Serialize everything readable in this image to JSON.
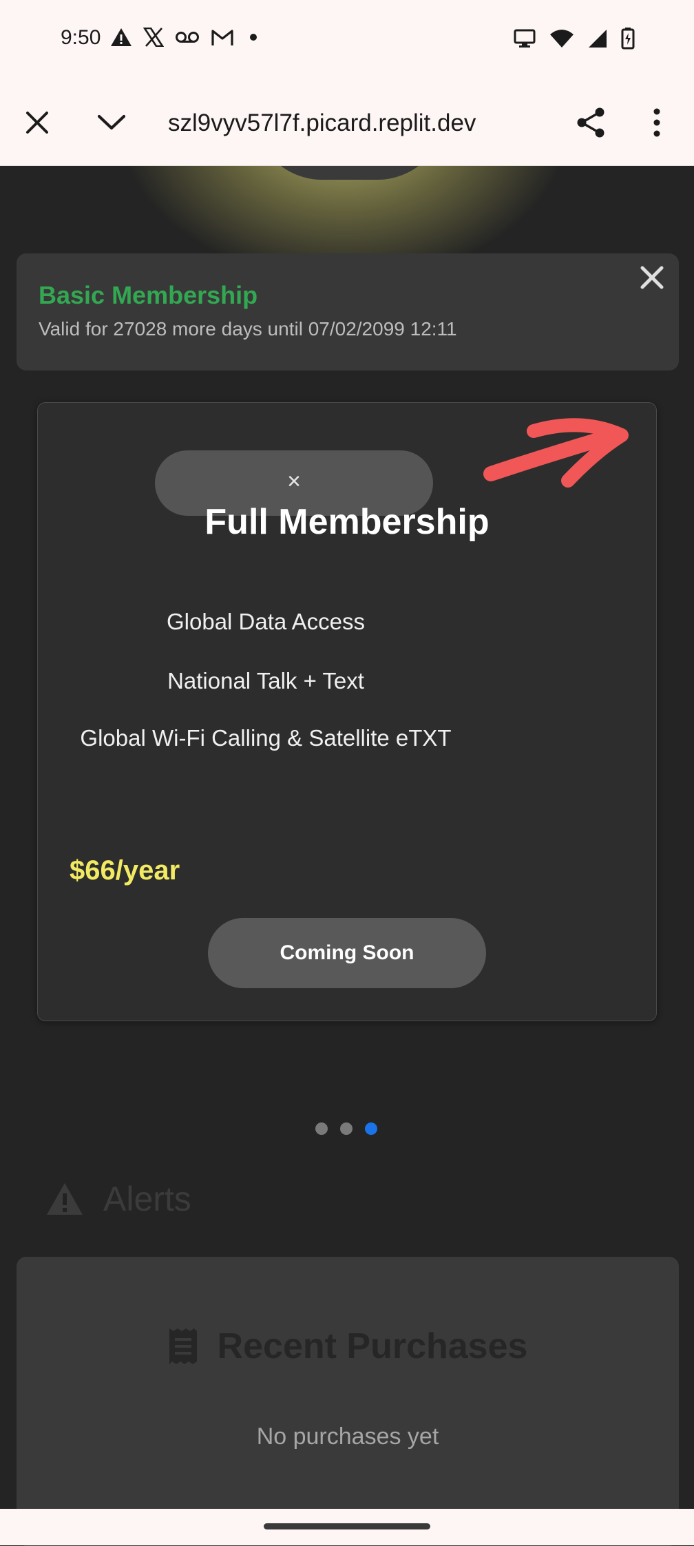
{
  "status_bar": {
    "time": "9:50",
    "left_icons": [
      "warning-icon",
      "x-icon",
      "voicemail-icon",
      "gmail-icon",
      "dot-icon"
    ],
    "right_icons": [
      "cast-icon",
      "wifi-icon",
      "signal-icon",
      "battery-charging-icon"
    ]
  },
  "browser": {
    "url": "szl9vyv57l7f.picard.replit.dev",
    "close_icon": "close-icon",
    "chevron_icon": "chevron-down-icon",
    "share_icon": "share-icon",
    "menu_icon": "more-vert-icon"
  },
  "basic_membership": {
    "title": "Basic Membership",
    "subtitle": "Valid for 27028 more days until 07/02/2099 12:11",
    "title_color": "#33a852"
  },
  "full_membership": {
    "close_label": "×",
    "title": "Full Membership",
    "features": [
      "Global Data Access",
      "National Talk + Text",
      "Global Wi-Fi Calling & Satellite eTXT"
    ],
    "price": "$66/year",
    "price_color": "#f2ea62",
    "button_label": "Coming Soon"
  },
  "carousel": {
    "page_count": 3,
    "active_page": 3,
    "active_color": "#1a73e8"
  },
  "alerts": {
    "label": "Alerts",
    "icon": "warning-icon"
  },
  "recent_purchases": {
    "title": "Recent Purchases",
    "icon": "receipt-icon",
    "empty_text": "No purchases yet"
  }
}
